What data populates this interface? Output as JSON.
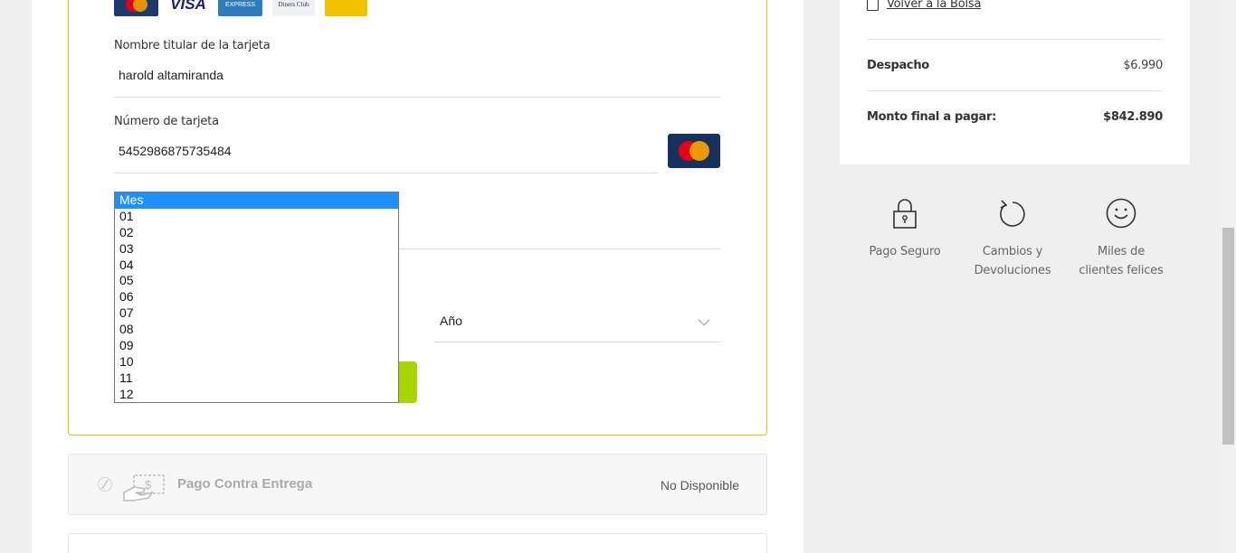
{
  "payment_card": {
    "logos": [
      "mastercard-logo",
      "visa-logo",
      "amex-logo",
      "diners-club-logo",
      "other-card-logo"
    ],
    "visa_text": "VISA",
    "amex_text": "EXPRESS",
    "diners_text": "Diners Club",
    "holder_label": "Nombre titular de la tarjeta",
    "holder_value": "harold altamiranda",
    "number_label": "Número de tarjeta",
    "number_value": "5452986875735484",
    "month_select": {
      "options": [
        "Mes",
        "01",
        "02",
        "03",
        "04",
        "05",
        "06",
        "07",
        "08",
        "09",
        "10",
        "11",
        "12"
      ],
      "selected": "Mes"
    },
    "year_select": {
      "value": "Año"
    }
  },
  "cash_on_delivery": {
    "title": "Pago Contra Entrega",
    "status": "No Disponible"
  },
  "summary": {
    "back_link": "Volver a la Bolsa",
    "shipping_label": "Despacho",
    "shipping_value": "$6.990",
    "total_label": "Monto final a pagar:",
    "total_value": "$842.890"
  },
  "benefits": {
    "secure": "Pago Seguro",
    "returns_line1": "Cambios y",
    "returns_line2": "Devoluciones",
    "happy_line1": "Miles de",
    "happy_line2": "clientes felices"
  },
  "colors": {
    "accent_green": "#a8d400",
    "panel_border": "#c8cc00",
    "dropdown_selected": "#1e90ff"
  }
}
